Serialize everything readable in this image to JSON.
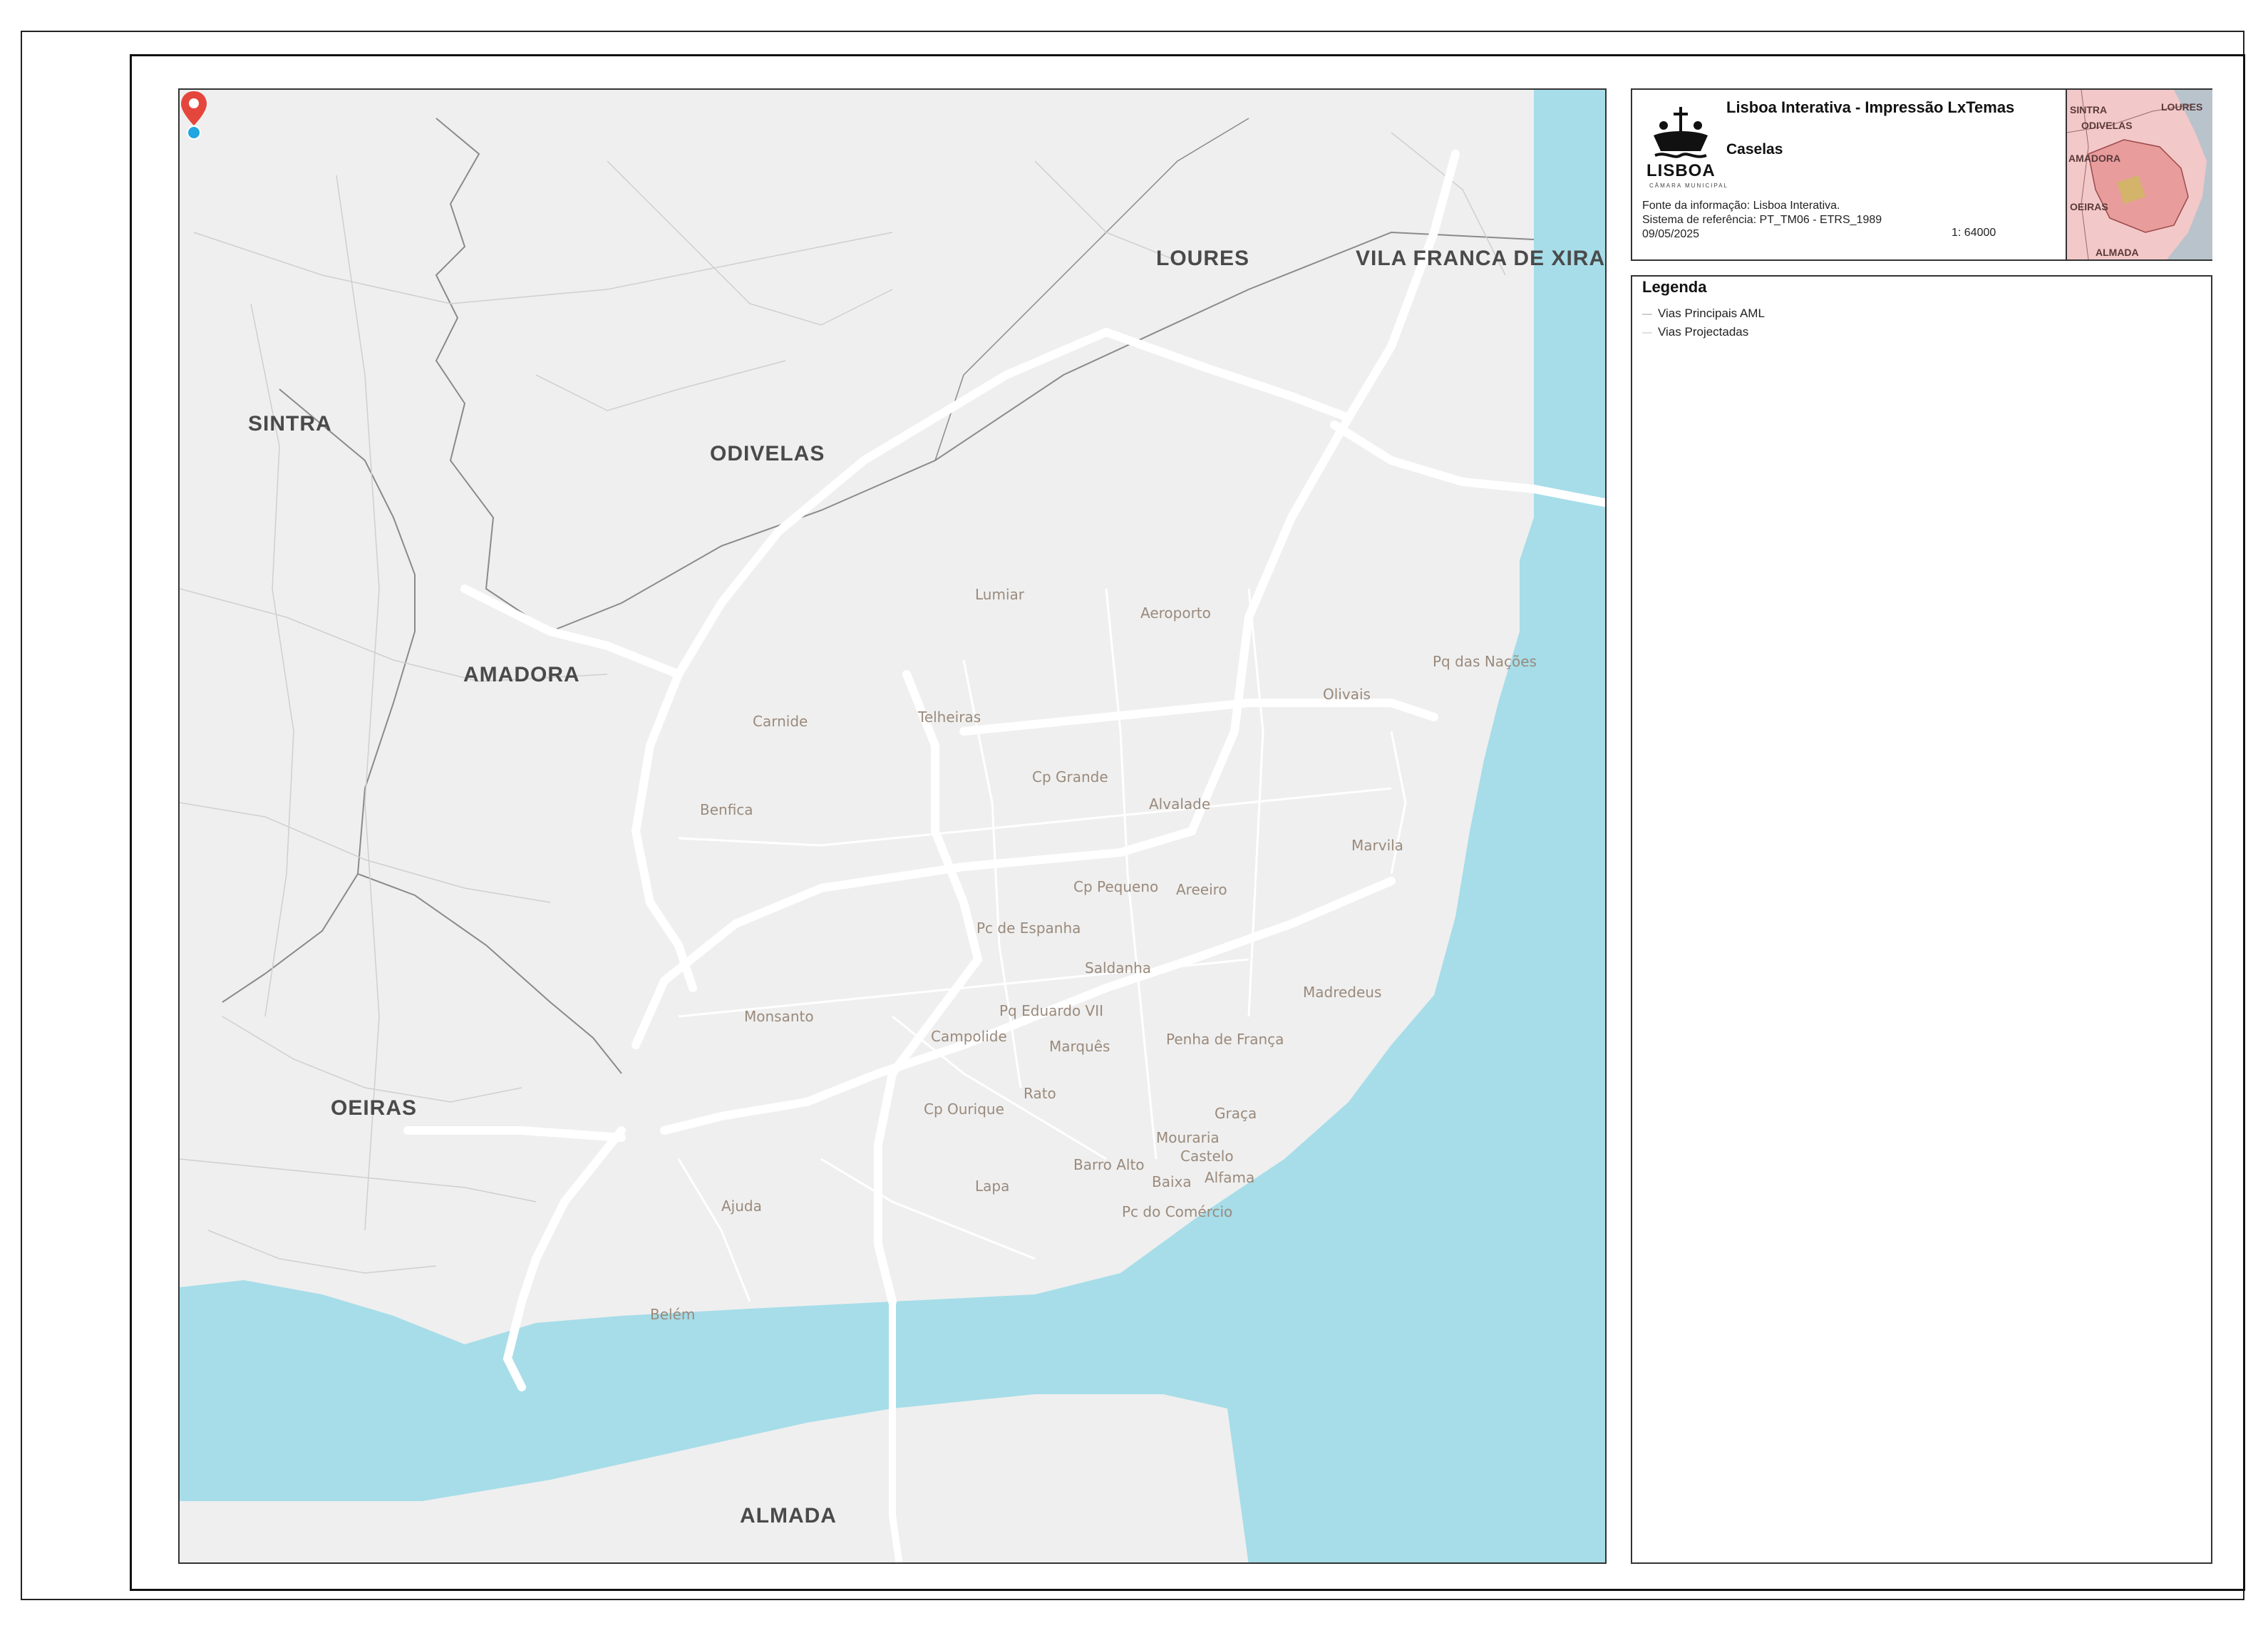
{
  "header": {
    "app_title": "Lisboa Interativa - Impressão LxTemas",
    "map_name": "Caselas",
    "source": "Fonte da informação: Lisboa Interativa.",
    "reference_system": "Sistema de referência: PT_TM06 - ETRS_1989",
    "date": "09/05/2025",
    "scale": "1: 64000",
    "logo_text": "LISBOA",
    "logo_subtext": "CÂMARA MUNICIPAL",
    "logo_icon": "lisboa-ship-crest-icon"
  },
  "inset_map": {
    "labels": [
      "SINTRA",
      "LOURES",
      "ODIVELAS",
      "AMADORA",
      "OEIRAS",
      "ALMADA"
    ]
  },
  "legend": {
    "title": "Legenda",
    "items": [
      {
        "label": "Vias Principais AML",
        "color": "#cfcfcf"
      },
      {
        "label": "Vias Projectadas",
        "color": "#e0e0e0"
      }
    ]
  },
  "map": {
    "water_color": "#a6dde9",
    "land_color": "#efefef",
    "road_color": "#ffffff",
    "marker_color": "#e5463c",
    "marker_icon": "map-pin-icon",
    "municipalities": [
      "LOURES",
      "VILA FRANCA DE XIRA",
      "SINTRA",
      "ODIVELAS",
      "AMADORA",
      "OEIRAS",
      "ALMADA"
    ],
    "neighbourhoods": [
      "Lumiar",
      "Aeroporto",
      "Pq das Nações",
      "Olivais",
      "Carnide",
      "Telheiras",
      "Cp Grande",
      "Benfica",
      "Alvalade",
      "Marvila",
      "Cp Pequeno",
      "Areeiro",
      "Pc de Espanha",
      "Saldanha",
      "Madredeus",
      "Monsanto",
      "Pq Eduardo VII",
      "Campolide",
      "Marquês",
      "Penha de França",
      "Rato",
      "Cp Ourique",
      "Graça",
      "Mouraria",
      "Castelo",
      "Barro Alto",
      "Alfama",
      "Baixa",
      "Ajuda",
      "Lapa",
      "Pc do Comércio",
      "Belém"
    ]
  }
}
